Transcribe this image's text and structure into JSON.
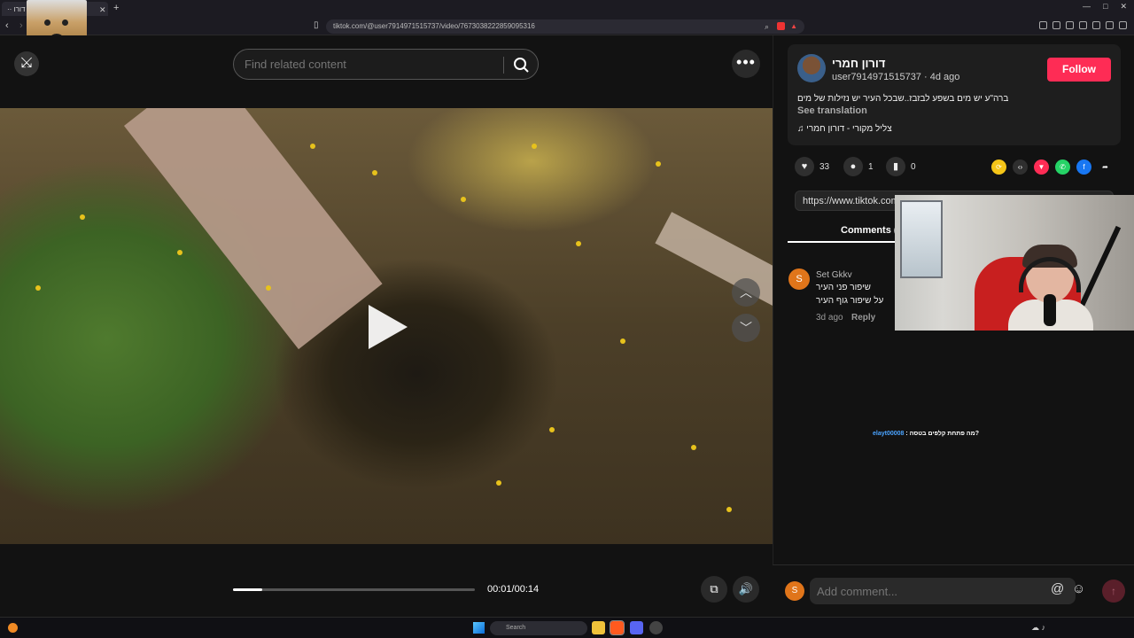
{
  "browser": {
    "tab_title": "·· דורו",
    "new_tab": "+",
    "url": "tiktok.com/@user7914971515737/video/7673038222859095316",
    "window_controls": [
      "—",
      "□",
      "✕"
    ]
  },
  "video": {
    "close_icon": "⤩",
    "search_placeholder": "Find related content",
    "more_label": "•••",
    "time": "00:01/00:14",
    "progress": 0.12,
    "nav_up": "︿",
    "nav_down": "﹀"
  },
  "post": {
    "author": "דורון חמרי",
    "handle": "user7914971515737 · 4d ago",
    "follow_label": "Follow",
    "caption": "ברה\"ע יש מים בשפע לבזבז..שבכל העיר יש נזילות של מים",
    "see_translation": "See translation",
    "sound": "♫ צליל מקורי - דורון חמרי",
    "likes": "33",
    "comments_count": "1",
    "saves": "0",
    "link": "https://www.tiktok.com/@user7914971515737/video/7673038222859095316",
    "share_colors": [
      "#f5c518",
      "#2f2f2f",
      "#fe2c55",
      "#25d366",
      "#1877f2",
      "#121212"
    ]
  },
  "tabs": {
    "comments_label": "Comments ("
  },
  "comment": {
    "avatar_letter": "S",
    "user": "Set Gkkv",
    "line1": "שיפור פני העיר",
    "line2": "על שיפור גוף העיר",
    "time": "3d ago",
    "reply": "Reply"
  },
  "chat": {
    "user": "elayt00008",
    "message": ": מה פתחת קלפים בטסה?"
  },
  "composer": {
    "avatar_letter": "S",
    "placeholder": "Add comment...",
    "at": "@",
    "emoji": "☺",
    "post": "↑"
  },
  "taskbar": {
    "search_placeholder": "Search"
  }
}
